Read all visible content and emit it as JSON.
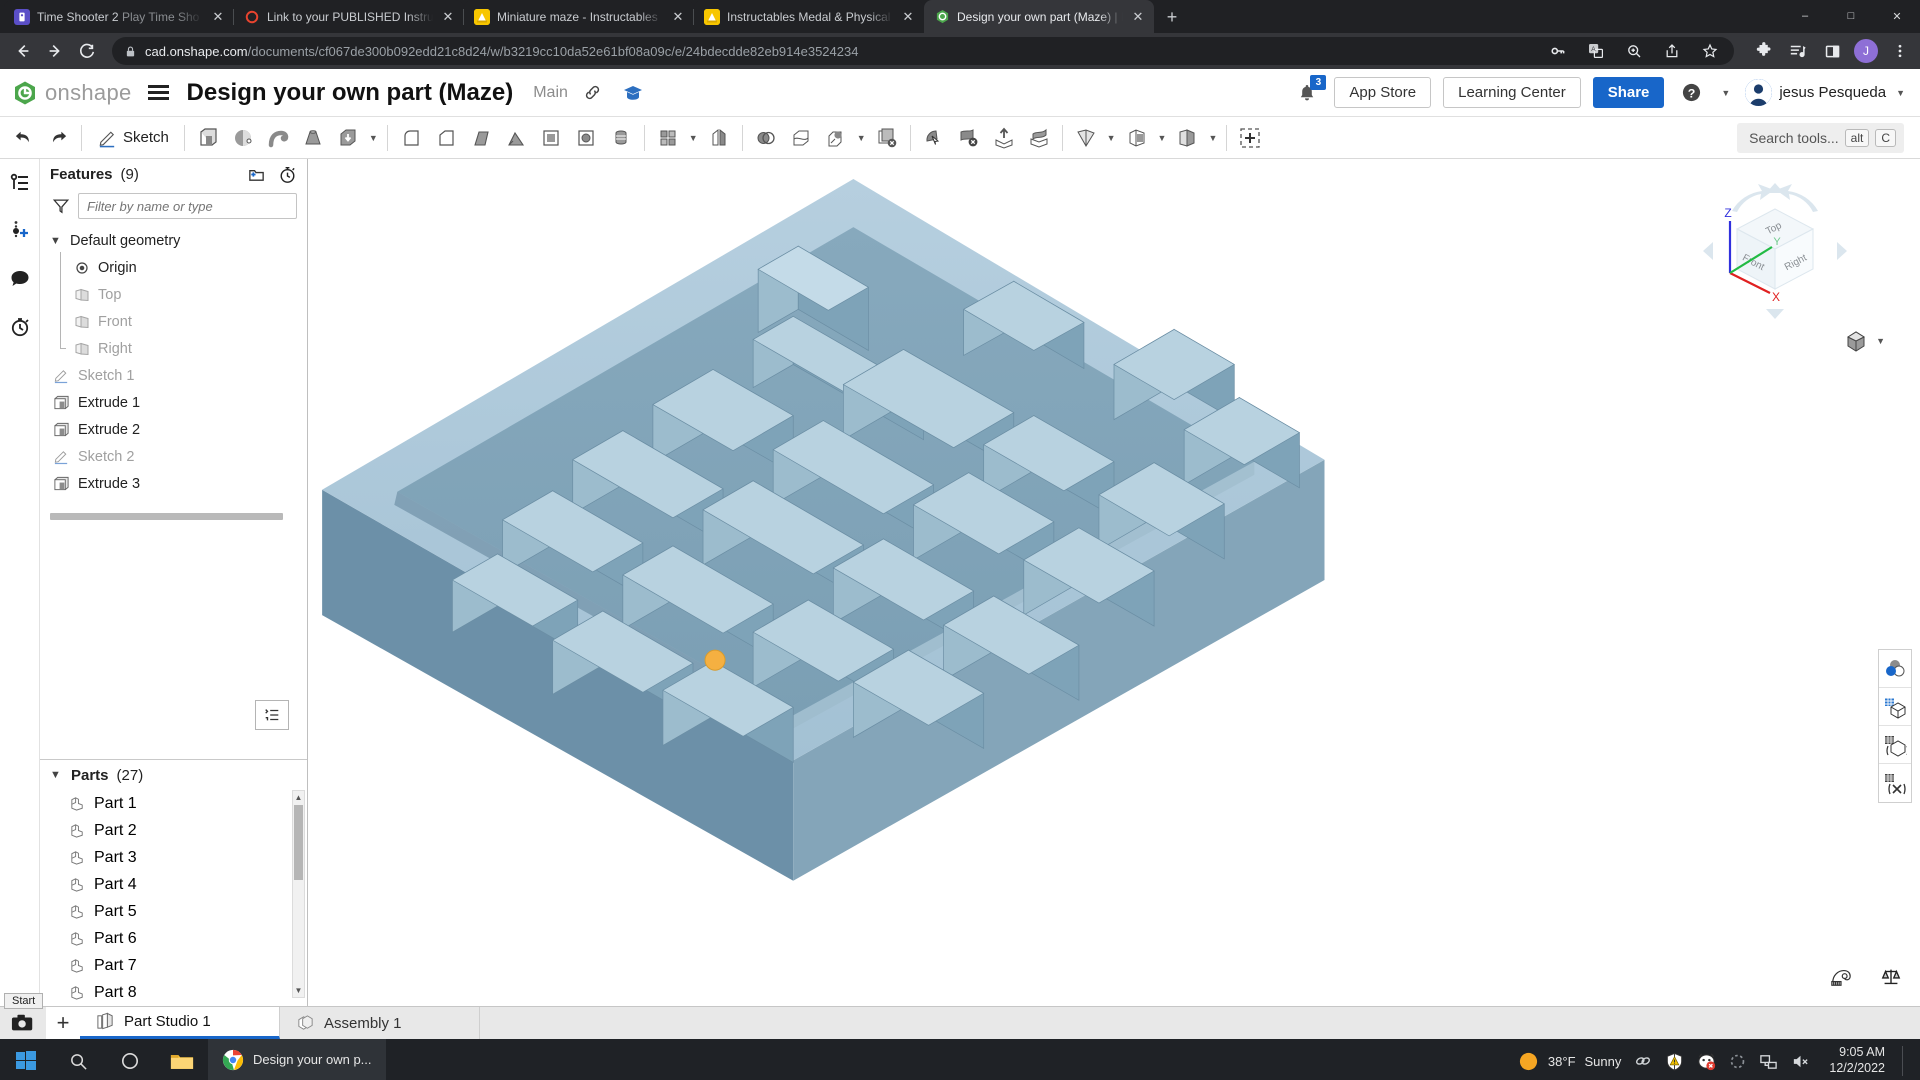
{
  "browser": {
    "tabs": [
      {
        "title": "Time Shooter 2 ",
        "title_dim": "Play Time Sho",
        "favicon": "time-shooter-icon",
        "active": false
      },
      {
        "title": "Link to your PUBLISHED Instructa",
        "title_dim": "",
        "favicon": "instructables-ring-icon",
        "active": false
      },
      {
        "title": "Miniature maze - Instructables",
        "title_dim": "",
        "favicon": "instructables-icon",
        "active": false
      },
      {
        "title": "Instructables Medal & Physical C",
        "title_dim": "",
        "favicon": "instructables-icon",
        "active": false
      },
      {
        "title": "Design your own part (Maze) | ",
        "title_dim": "Pa",
        "favicon": "onshape-icon",
        "active": true
      }
    ],
    "new_tab_label": "+",
    "window_controls": {
      "minimize": "–",
      "maximize": "□",
      "close": "✕"
    },
    "nav": {
      "back": "←",
      "forward": "→",
      "reload": "⟳"
    },
    "url_host": "cad.onshape.com",
    "url_path": "/documents/cf067de300b092edd21c8d24/w/b3219cc10da52e61bf08a09c/e/24bdecdde82eb914e3524234",
    "omnibox_icons": [
      "password-key-icon",
      "translate-icon",
      "zoom-icon",
      "share-icon",
      "bookmark-star-icon"
    ],
    "extension_icons": [
      "puzzle-extensions-icon",
      "reading-list-icon",
      "sidebar-panel-icon"
    ],
    "profile_initial": "J",
    "menu_icon": "three-dot-menu-icon"
  },
  "onshape": {
    "logo_text": "onshape",
    "document_title": "Design your own part (Maze)",
    "branch": "Main",
    "notification_count": "3",
    "app_store_label": "App Store",
    "learning_center_label": "Learning Center",
    "share_label": "Share",
    "user_name": "jesus Pesqueda",
    "toolbar": {
      "undo": "undo-icon",
      "redo": "redo-icon",
      "sketch_label": "Sketch",
      "search_placeholder": "Search tools...",
      "search_kbd_alt": "alt",
      "search_kbd_key": "C",
      "tools": [
        "extrude-icon",
        "revolve-icon",
        "sweep-icon",
        "loft-icon",
        "thicken-icon",
        "fillet-icon",
        "chamfer-icon",
        "draft-icon",
        "rib-icon",
        "shell-icon",
        "hole-icon",
        "thread-icon",
        "linear-pattern-icon",
        "mirror-icon",
        "boolean-icon",
        "split-icon",
        "transform-icon",
        "delete-face-icon",
        "move-face-icon",
        "delete-part-icon",
        "import-icon",
        "export-icon",
        "plane-icon",
        "sketch-plane-icon",
        "derive-icon",
        "insert-icon"
      ]
    },
    "rail_icons": [
      "versions-branches-icon",
      "add-version-icon",
      "comments-icon",
      "history-icon"
    ],
    "features_panel": {
      "title": "Features",
      "count": "(9)",
      "head_icons": [
        "new-folder-icon",
        "rollback-timer-icon"
      ],
      "filter_icon": "funnel-filter-icon",
      "filter_placeholder": "Filter by name or type",
      "nodes": [
        {
          "label": "Default geometry",
          "icon": "chevron-down-icon",
          "type": "group",
          "dim": false
        },
        {
          "label": "Origin",
          "icon": "origin-icon",
          "type": "child",
          "dim": false
        },
        {
          "label": "Top",
          "icon": "plane-icon",
          "type": "child",
          "dim": true
        },
        {
          "label": "Front",
          "icon": "plane-icon",
          "type": "child",
          "dim": true
        },
        {
          "label": "Right",
          "icon": "plane-icon",
          "type": "child",
          "dim": true
        },
        {
          "label": "Sketch 1",
          "icon": "sketch-icon",
          "type": "feature",
          "dim": true
        },
        {
          "label": "Extrude 1",
          "icon": "extrude-icon",
          "type": "feature",
          "dim": false
        },
        {
          "label": "Extrude 2",
          "icon": "extrude-icon",
          "type": "feature",
          "dim": false
        },
        {
          "label": "Sketch 2",
          "icon": "sketch-icon",
          "type": "feature",
          "dim": true
        },
        {
          "label": "Extrude 3",
          "icon": "extrude-icon",
          "type": "feature",
          "dim": false
        }
      ],
      "rollback_icon": "feature-list-icon"
    },
    "parts_panel": {
      "title": "Parts",
      "count": "(27)",
      "chevron": "chevron-down-icon",
      "items": [
        {
          "label": "Part 1",
          "icon": "part-icon"
        },
        {
          "label": "Part 2",
          "icon": "part-icon"
        },
        {
          "label": "Part 3",
          "icon": "part-icon"
        },
        {
          "label": "Part 4",
          "icon": "part-icon"
        },
        {
          "label": "Part 5",
          "icon": "part-icon"
        },
        {
          "label": "Part 6",
          "icon": "part-icon"
        },
        {
          "label": "Part 7",
          "icon": "part-icon"
        },
        {
          "label": "Part 8",
          "icon": "part-icon"
        }
      ]
    },
    "viewcube": {
      "faces": {
        "top": "Top",
        "front": "Front",
        "right": "Right"
      },
      "axes": {
        "x": "X",
        "y": "Y",
        "z": "Z"
      },
      "axis_colors": {
        "x": "#e02020",
        "y": "#22bb44",
        "z": "#3030dd"
      },
      "display_mode_icon": "shaded-cube-icon"
    },
    "viewport_tools": [
      "appearance-icon",
      "display-state-icon",
      "measure-tool-icon",
      "section-view-icon"
    ],
    "viewport_bottom_icons": [
      "measure-tape-icon",
      "mass-properties-icon"
    ],
    "model_color": "#8fb3c9",
    "highlight_color": "#f5b041",
    "bottom_tabs": [
      {
        "label": "Part Studio 1",
        "icon": "part-studio-icon",
        "active": true
      },
      {
        "label": "Assembly 1",
        "icon": "assembly-icon",
        "active": false
      }
    ],
    "add_tab_label": "+",
    "camera_icon": "camera-icon",
    "start_tooltip": "Start"
  },
  "taskbar": {
    "start_icon": "windows-start-icon",
    "search_icon": "search-icon",
    "cortana_icon": "cortana-circle-icon",
    "explorer_icon": "file-explorer-icon",
    "app_label": "Design your own p...",
    "app_icon": "chrome-icon",
    "weather_temp": "38°F",
    "weather_desc": "Sunny",
    "weather_icon": "sun-icon",
    "tray_icons": [
      "link-chain-icon",
      "defender-warning-icon",
      "antivirus-error-icon",
      "loading-spinner-icon",
      "network-icon",
      "volume-mute-icon"
    ],
    "time": "9:05 AM",
    "date": "12/2/2022"
  }
}
